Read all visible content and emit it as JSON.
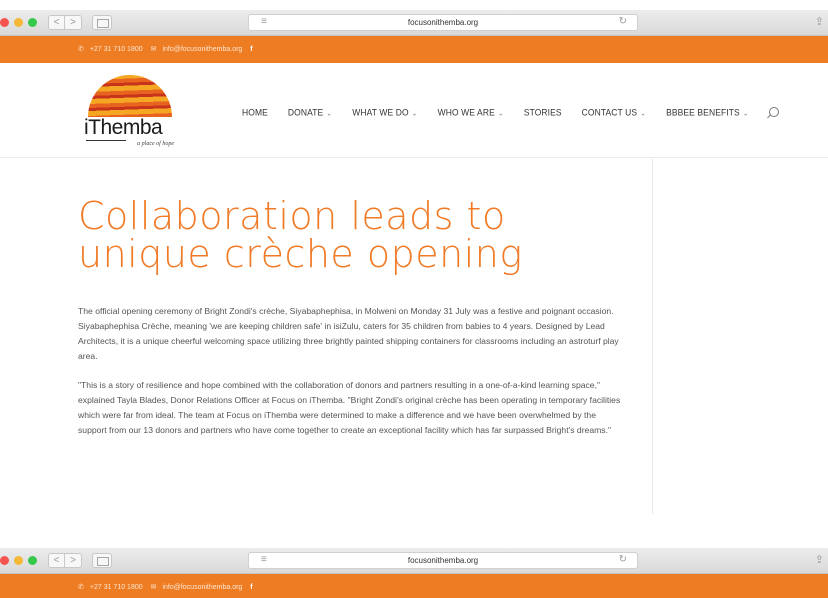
{
  "browser": {
    "url": "focusonithemba.org",
    "reader_icon": "reader-icon",
    "reload_icon": "reload-icon",
    "share_icon": "share-icon",
    "back_glyph": "<",
    "forward_glyph": ">",
    "reload_glyph": "↻",
    "share_glyph": "⇪",
    "reader_glyph": "≡",
    "lights": [
      "#f5534d",
      "#f5b836",
      "#36c84a"
    ]
  },
  "topbar": {
    "phone": "+27 31 710 1800",
    "email": "info@focusonithemba.org",
    "facebook": "f",
    "color": "#ee7c23"
  },
  "logo": {
    "name": "iThemba",
    "tagline": "a place of hope"
  },
  "nav": {
    "items": [
      {
        "label": "HOME",
        "dropdown": false
      },
      {
        "label": "DONATE",
        "dropdown": true
      },
      {
        "label": "WHAT WE DO",
        "dropdown": true
      },
      {
        "label": "WHO WE ARE",
        "dropdown": true
      },
      {
        "label": "STORIES",
        "dropdown": false
      },
      {
        "label": "CONTACT US",
        "dropdown": true
      },
      {
        "label": "BBBEE BENEFITS",
        "dropdown": true
      }
    ],
    "caret": "⌄",
    "search_icon": "search-icon"
  },
  "article": {
    "title": "Collaboration leads to unique crèche opening",
    "paragraphs": [
      "The official opening ceremony of Bright Zondi's crèche, Siyabaphephisa, in Molweni on Monday 31 July was a festive and poignant occasion. Siyabaphephisa Crèche, meaning 'we are keeping children safe' in isiZulu, caters for 35 children from babies to 4 years. Designed by Lead Architects, it is a unique cheerful welcoming space utilizing three brightly painted shipping containers for classrooms including an astroturf play area.",
      "\"This is a story of resilience and hope combined with the collaboration of donors and partners resulting in a one-of-a-kind learning space,\" explained Tayla Blades, Donor Relations Officer at Focus on iThemba. \"Bright Zondi's original crèche has been operating in temporary facilities which were far from ideal. The team at Focus on iThemba were determined to make a difference and we have been overwhelmed by the support from our 13 donors and partners who have come together to create an exceptional facility which has far surpassed Bright's dreams.\""
    ],
    "accent_color": "#f07a26"
  }
}
